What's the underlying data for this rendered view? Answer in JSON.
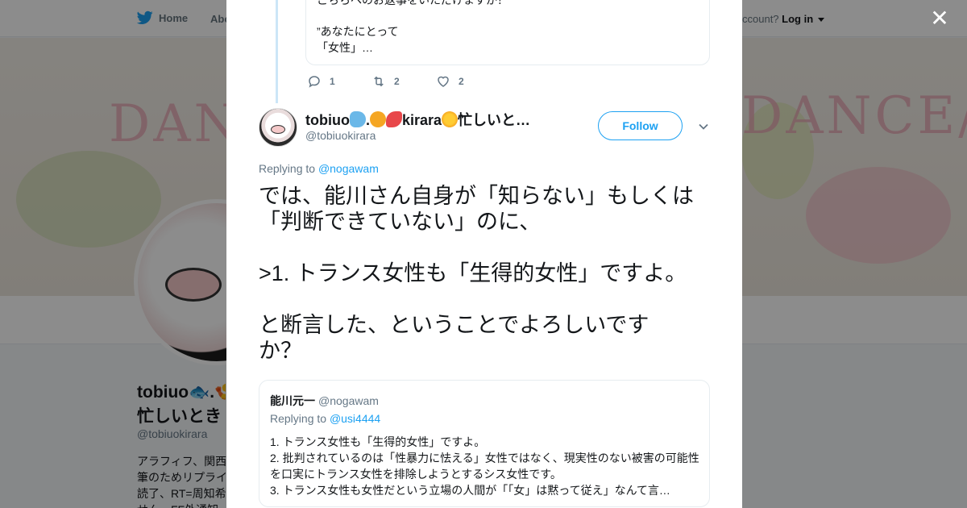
{
  "nav": {
    "home_label": "Home",
    "about_label": "Abo",
    "account_prompt": "ccount?",
    "login_label": "Log in"
  },
  "banner": {
    "left_word": "DANCE",
    "right_word": "DANCE/"
  },
  "profile": {
    "name_line1": "tobiuo🐟.🍤",
    "name_line2": "忙しいとき",
    "handle": "@tobiuokirara",
    "bio_lines": [
      "アラフィフ、関西",
      "筆のためリプライ",
      "読了、RT=周知希",
      "せん。FF外通知"
    ]
  },
  "previous_tweet": {
    "partial_line": "こちらへのお返事をいただけますか？",
    "quote_line": "”あなたにとって",
    "quote_line2": "「女性」…",
    "replies": "1",
    "retweets": "2",
    "likes": "2"
  },
  "tweet": {
    "author_name_prefix": "tobiuo",
    "author_name_mid": ".",
    "author_name_kirara": "kirara",
    "author_name_suffix": "忙しいと…",
    "handle": "@tobiuokirara",
    "follow_label": "Follow",
    "replying_prefix": "Replying to",
    "replying_handle": "@nogawam",
    "text_lines": [
      "では、能川さん自身が「知らない」もしくは",
      "「判断できていない」のに、",
      "",
      ">1. トランス女性も「生得的女性」ですよ。",
      "",
      "と断言した、ということでよろしいです",
      "か？"
    ]
  },
  "quoted_tweet": {
    "name": "能川元一",
    "handle": "@nogawam",
    "replying_prefix": "Replying to",
    "replying_handle": "@usi4444",
    "lines": [
      "1. トランス女性も「生得的女性」ですよ。",
      "2. 批判されているのは「性暴力に怯える」女性ではなく、現実性のない被害の可能性",
      "を口実にトランス女性を排除しようとするシス女性です。",
      "3. トランス女性も女性だという立場の人間が「「女」は黙って従え」なんて言…"
    ]
  },
  "colors": {
    "accent": "#1da1f2",
    "muted": "#657786",
    "thread_line": "#cce6f7"
  }
}
